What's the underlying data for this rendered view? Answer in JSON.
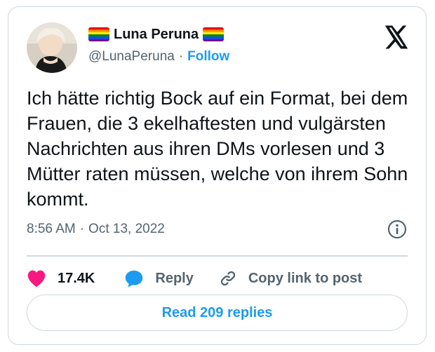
{
  "author": {
    "name": "Luna Peruna",
    "handle": "@LunaPeruna",
    "follow_label": "Follow",
    "flag_icon": "rainbow-flag-emoji"
  },
  "tweet": {
    "text": "Ich hätte richtig Bock auf ein Format, bei dem Frauen, die 3 ekelhaftesten und vulgärsten Nachrichten aus ihren DMs vorlesen und 3 Mütter raten müssen, welche von ihrem Sohn kommt.",
    "time": "8:56 AM",
    "date": "Oct 13, 2022"
  },
  "actions": {
    "likes": "17.4K",
    "reply_label": "Reply",
    "copy_label": "Copy link to post",
    "read_replies_label": "Read 209 replies"
  },
  "colors": {
    "accent": "#1d9bf0",
    "like": "#f91880",
    "text": "#0f1419",
    "muted": "#536471",
    "border": "#cfd9de"
  }
}
